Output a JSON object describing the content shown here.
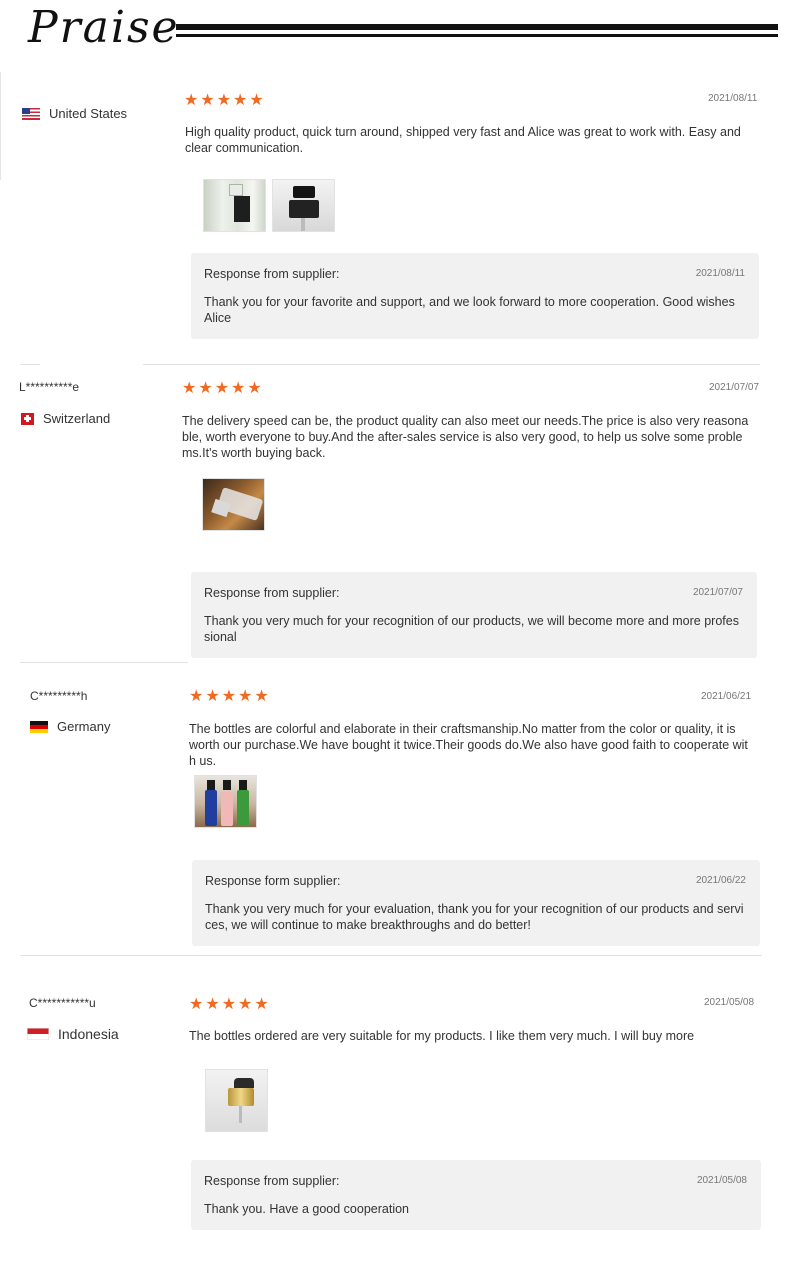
{
  "page": {
    "title": "Praise"
  },
  "colors": {
    "star": "#f26a21",
    "response_bg": "#f1f1f1",
    "divider": "#e2e2e2"
  },
  "reviews": [
    {
      "username": "",
      "country": "United States",
      "flag_icon": "flag-us-icon",
      "rating": 5,
      "date": "2021/08/11",
      "text": "High quality product, quick turn around, shipped very fast and Alice was great to work with. Easy and clear communication.",
      "photos": 2,
      "response": {
        "label": "Response from supplier:",
        "date": "2021/08/11",
        "text": "Thank you for your favorite and support, and we look forward to more cooperation. Good wishes Alice"
      }
    },
    {
      "username": "L**********e",
      "country": "Switzerland",
      "flag_icon": "flag-switzerland-icon",
      "rating": 5,
      "date": "2021/07/07",
      "text": "The delivery speed can be, the product quality can also meet our needs.The price is also very reasona ble, worth everyone to buy.And the after-sales service is also very good, to help us solve some proble ms.It's worth buying back.",
      "photos": 1,
      "response": {
        "label": "Response from supplier:",
        "date": "2021/07/07",
        "text": "Thank you very much for your recognition of our products, we will become more and more profes sional"
      }
    },
    {
      "username": "C*********h",
      "country": "Germany",
      "flag_icon": "flag-germany-icon",
      "rating": 5,
      "date": "2021/06/21",
      "text": "The bottles are colorful and elaborate in their craftsmanship.No matter from the color or quality, it is worth our purchase.We have bought it twice.Their goods do.We also have good faith to cooperate wit h us.",
      "photos": 1,
      "response": {
        "label": "Response form supplier:",
        "date": "2021/06/22",
        "text": "Thank you very much for your evaluation, thank you for your recognition of our products and servi ces, we will continue to make breakthroughs and do better!"
      }
    },
    {
      "username": "C***********u",
      "country": "Indonesia",
      "flag_icon": "flag-indonesia-icon",
      "rating": 5,
      "date": "2021/05/08",
      "text": "The bottles ordered are very suitable for my products. I like them very much. I will buy more",
      "photos": 1,
      "response": {
        "label": "Response from supplier:",
        "date": "2021/05/08",
        "text": "Thank you. Have a good cooperation"
      }
    }
  ]
}
